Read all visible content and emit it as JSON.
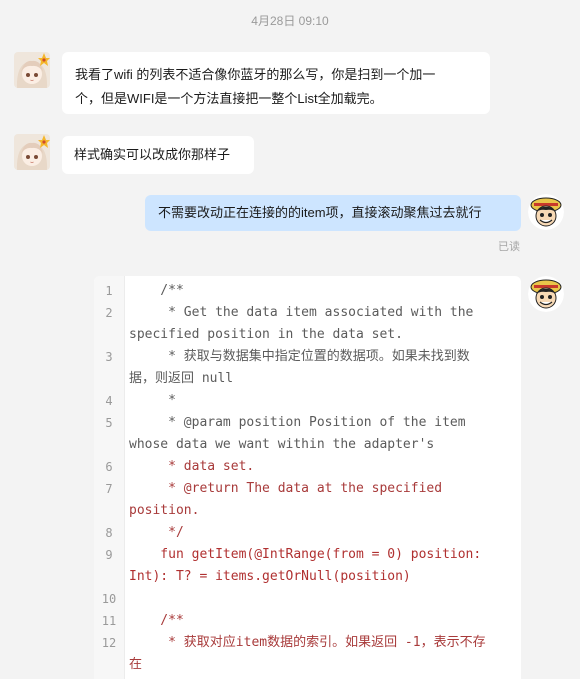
{
  "timestamp": "4月28日 09:10",
  "messages": [
    {
      "sender": "them",
      "line1": "我看了wifi 的列表不适合像你蓝牙的那么写，你是扫到一个加一",
      "line2": "个，但是WIFI是一个方法直接把一整个List全加载完。"
    },
    {
      "sender": "them",
      "line1": "样式确实可以改成你那样子"
    },
    {
      "sender": "me",
      "line1": "不需要改动正在连接的的item项，直接滚动聚焦过去就行",
      "status": "已读"
    }
  ],
  "code": {
    "lines": [
      {
        "n": "1",
        "rows": [
          "    /**"
        ]
      },
      {
        "n": "2",
        "rows": [
          "     * Get the data item associated with the",
          "specified position in the data set."
        ]
      },
      {
        "n": "3",
        "rows": [
          "     * 获取与数据集中指定位置的数据项。如果未找到数",
          "据，则返回 null"
        ]
      },
      {
        "n": "4",
        "rows": [
          "     *"
        ]
      },
      {
        "n": "5",
        "rows": [
          "     * @param position Position of the item",
          "whose data we want within the adapter's"
        ]
      },
      {
        "n": "6",
        "rows": [
          "     * data set."
        ]
      },
      {
        "n": "7",
        "rows": [
          "     * @return The data at the specified",
          "position."
        ]
      },
      {
        "n": "8",
        "rows": [
          "     */"
        ]
      },
      {
        "n": "9",
        "rows": [
          "    fun getItem(@IntRange(from = 0) position:",
          "Int): T? = items.getOrNull(position)"
        ]
      },
      {
        "n": "10",
        "rows": [
          ""
        ]
      },
      {
        "n": "11",
        "rows": [
          "    /**"
        ]
      },
      {
        "n": "12",
        "rows": [
          "     * 获取对应item数据的索引。如果返回 -1，表示不存",
          "在"
        ]
      }
    ]
  },
  "colors": {
    "background": "#f3f3f3",
    "bubble_them": "#ffffff",
    "bubble_me": "#cde5ff"
  },
  "icons": [
    "girl-avatar-icon",
    "anime-avatar-icon"
  ]
}
